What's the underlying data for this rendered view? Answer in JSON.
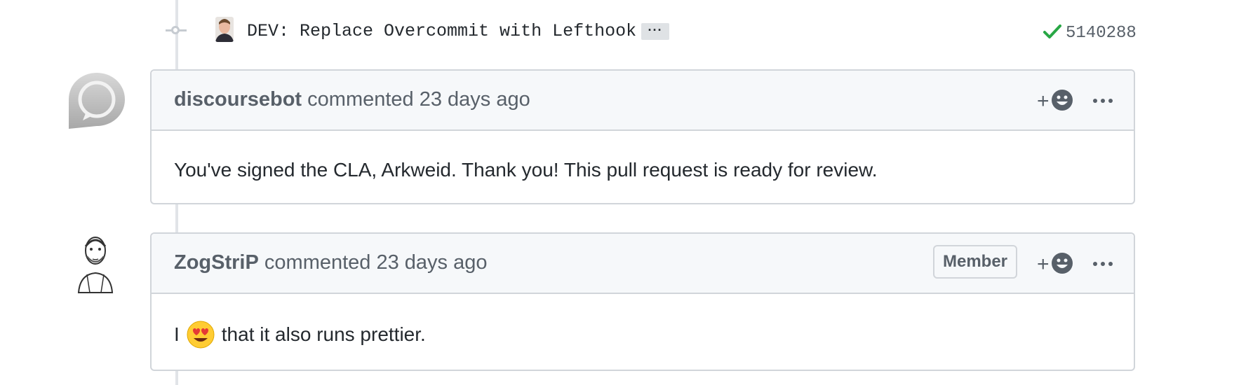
{
  "commit": {
    "message": "DEV: Replace Overcommit with Lefthook",
    "expand_label": "···",
    "status": "success",
    "sha": "5140288"
  },
  "comments": [
    {
      "author": "discoursebot",
      "meta": "commented 23 days ago",
      "body": "You've signed the CLA, Arkweid. Thank you! This pull request is ready for review."
    },
    {
      "author": "ZogStriP",
      "meta": "commented 23 days ago",
      "badge": "Member",
      "body_before": "I",
      "body_emoji": "heart-eyes",
      "body_after": "that it also runs prettier."
    }
  ],
  "colors": {
    "check": "#28a745",
    "border": "#d1d5da",
    "header_bg": "#f6f8fa",
    "timeline": "#e1e4e8"
  }
}
